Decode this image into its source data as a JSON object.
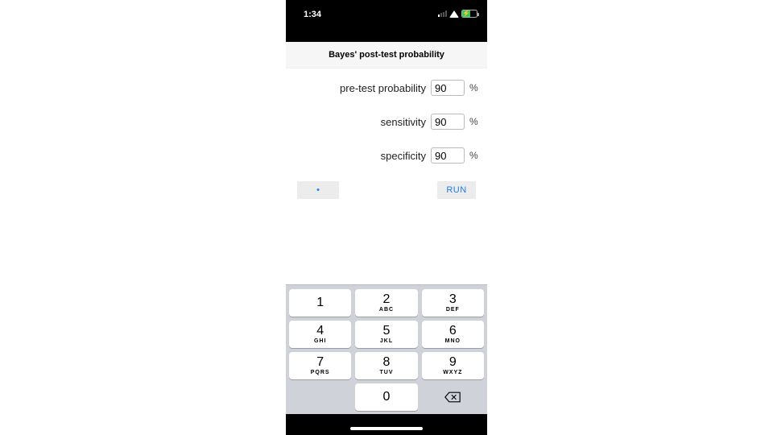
{
  "statusbar": {
    "time": "1:34"
  },
  "titlebar": {
    "title": "Bayes' post-test probability"
  },
  "form": {
    "pretest_label": "pre-test probability",
    "pretest_value": "90",
    "sensitivity_label": "sensitivity",
    "sensitivity_value": "90",
    "specificity_label": "specificity",
    "specificity_value": "90",
    "unit": "%"
  },
  "buttons": {
    "left_label": "•",
    "run_label": "RUN"
  },
  "keypad": {
    "keys": [
      {
        "num": "1",
        "letters": ""
      },
      {
        "num": "2",
        "letters": "ABC"
      },
      {
        "num": "3",
        "letters": "DEF"
      },
      {
        "num": "4",
        "letters": "GHI"
      },
      {
        "num": "5",
        "letters": "JKL"
      },
      {
        "num": "6",
        "letters": "MNO"
      },
      {
        "num": "7",
        "letters": "PQRS"
      },
      {
        "num": "8",
        "letters": "TUV"
      },
      {
        "num": "9",
        "letters": "WXYZ"
      },
      {
        "num": "0",
        "letters": ""
      }
    ]
  }
}
